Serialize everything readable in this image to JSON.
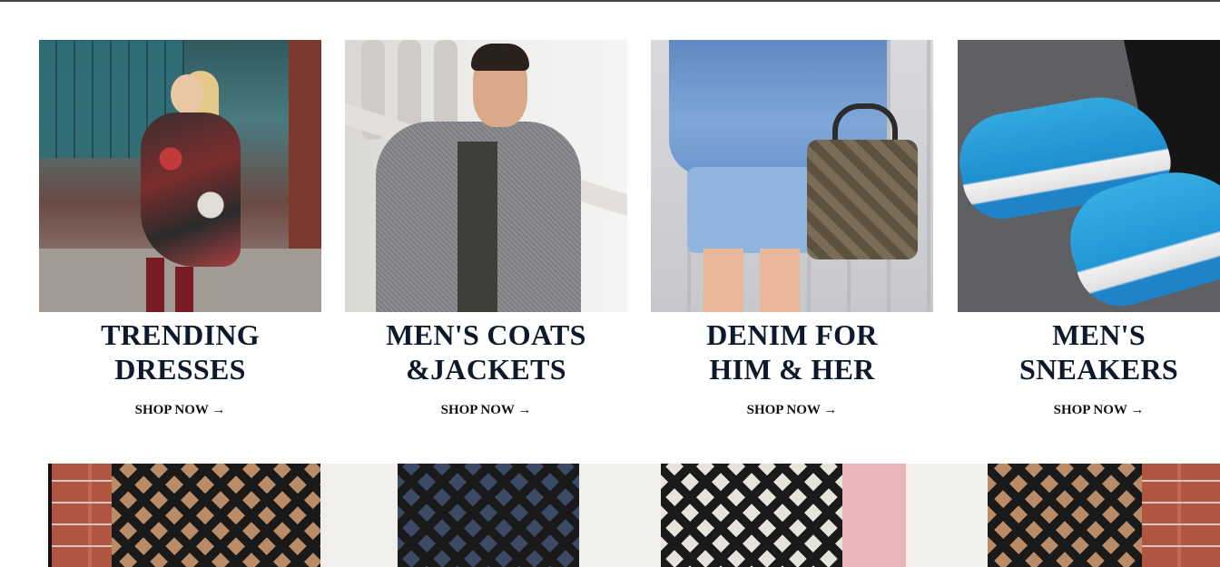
{
  "cards": [
    {
      "title": "TRENDING\nDRESSES",
      "cta": "SHOP NOW →"
    },
    {
      "title": "MEN'S COATS\n&JACKETS",
      "cta": "SHOP NOW →"
    },
    {
      "title": "DENIM FOR\nHIM & HER",
      "cta": "SHOP NOW →"
    },
    {
      "title": "MEN'S\nSNEAKERS",
      "cta": "SHOP NOW →"
    }
  ],
  "colors": {
    "heading": "#0e1a2b",
    "cta": "#111111",
    "background": "#ffffff"
  }
}
